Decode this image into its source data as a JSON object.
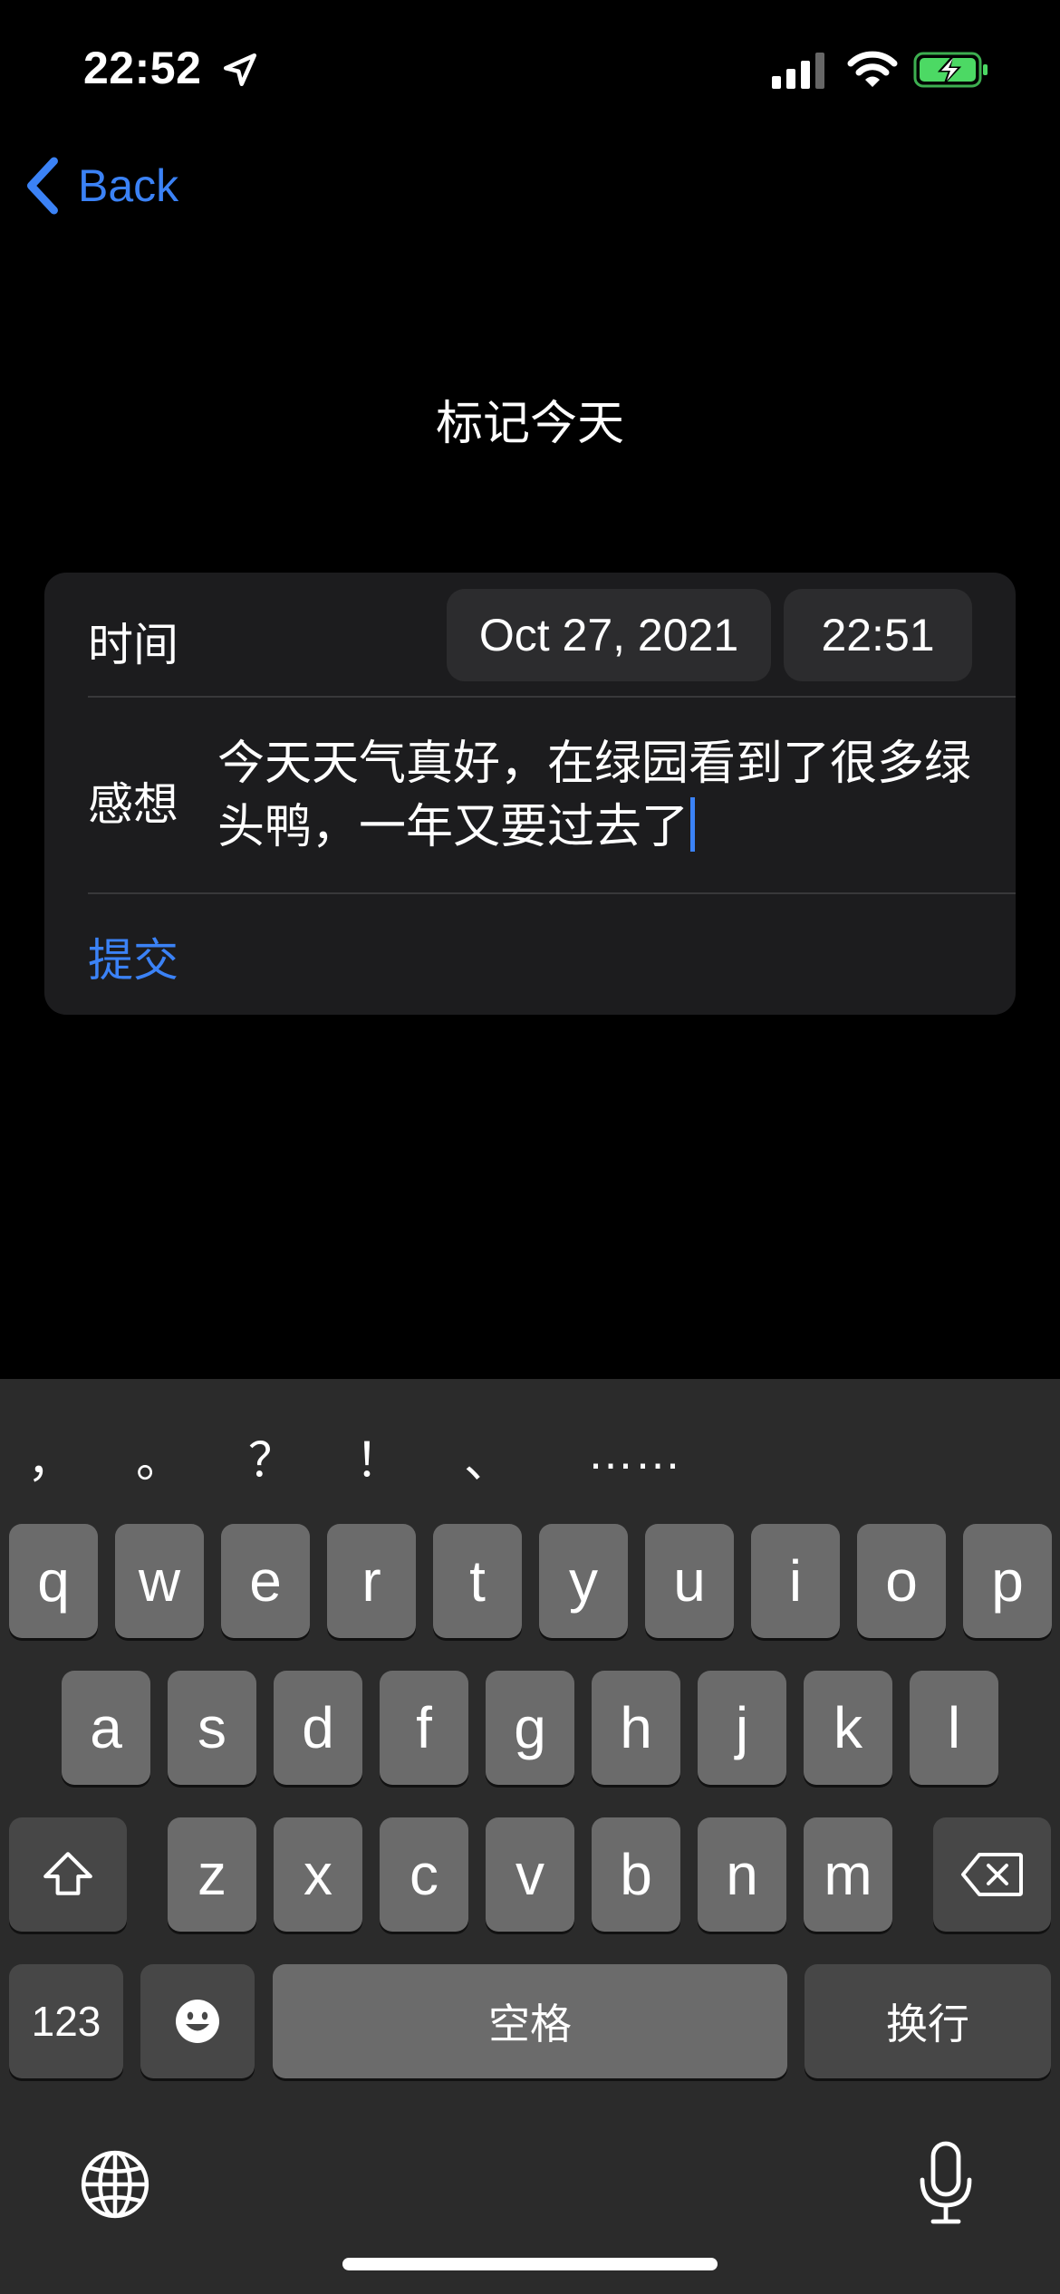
{
  "status_bar": {
    "time": "22:52",
    "icons": [
      "location-arrow-icon",
      "cellular-signal-icon",
      "wifi-icon",
      "battery-charging-icon"
    ],
    "battery_color": "#4cd964"
  },
  "nav": {
    "back_label": "Back"
  },
  "page": {
    "title": "标记今天"
  },
  "form": {
    "time_label": "时间",
    "date_value": "Oct 27, 2021",
    "time_value": "22:51",
    "note_label": "感想",
    "note_value": "今天天气真好，在绿园看到了很多绿头鸭，一年又要过去了",
    "submit_label": "提交"
  },
  "keyboard": {
    "punctuation": [
      "，",
      "。",
      "？",
      "！",
      "、",
      "……"
    ],
    "row1": [
      "q",
      "w",
      "e",
      "r",
      "t",
      "y",
      "u",
      "i",
      "o",
      "p"
    ],
    "row2": [
      "a",
      "s",
      "d",
      "f",
      "g",
      "h",
      "j",
      "k",
      "l"
    ],
    "row3": [
      "z",
      "x",
      "c",
      "v",
      "b",
      "n",
      "m"
    ],
    "numbers_label": "123",
    "space_label": "空格",
    "return_label": "换行"
  },
  "colors": {
    "accent": "#3b82f6",
    "card": "#1c1c1e",
    "pill": "#2c2c2e",
    "keyboard": "#2b2b2b"
  }
}
